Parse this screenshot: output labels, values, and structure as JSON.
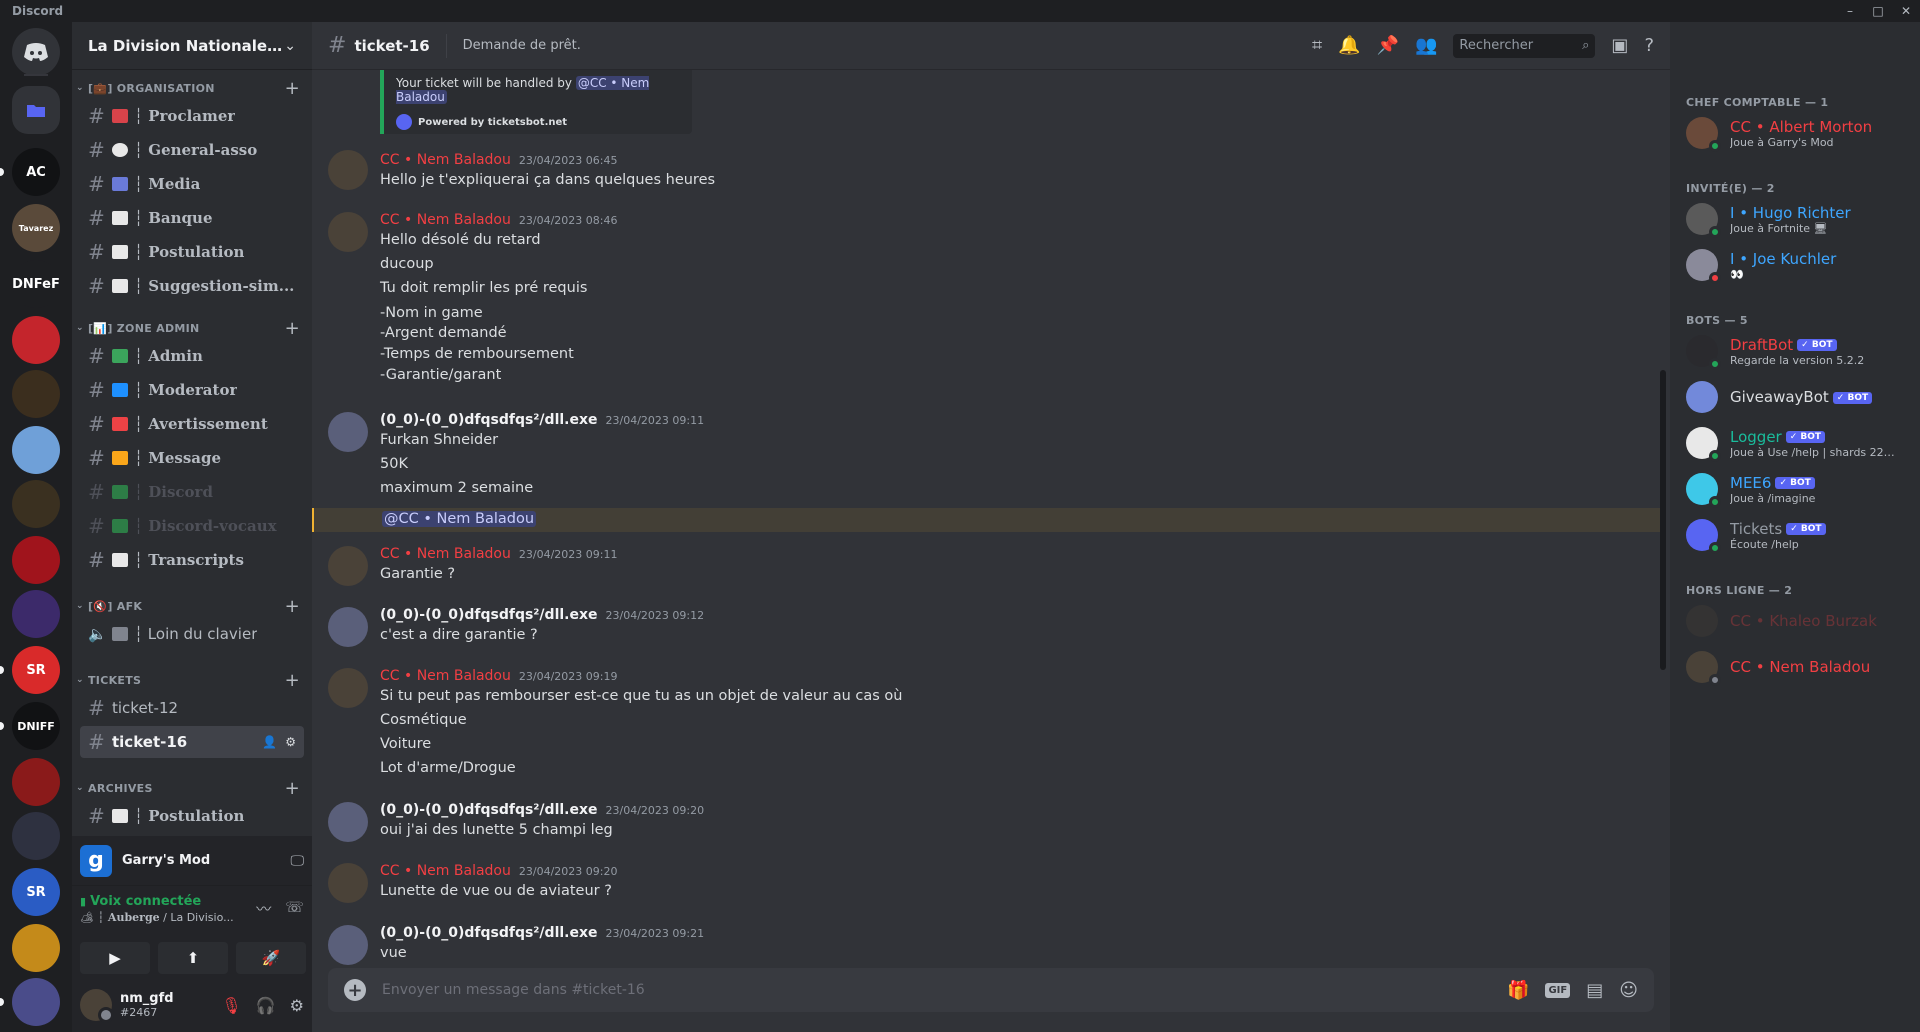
{
  "app": {
    "title": "Discord",
    "window_controls": [
      "–",
      "□",
      "✕"
    ]
  },
  "rail": {
    "servers": [
      {
        "label": "",
        "color": "#5865f2"
      },
      {
        "label": "AC",
        "color": "#111214"
      },
      {
        "label": "Tavarez",
        "color": "#5a4a3a"
      },
      {
        "label": "DNFeF",
        "color": "#1e1f22"
      },
      {
        "label": "",
        "color": "#c4252c"
      },
      {
        "label": "",
        "color": "#3b2e1e"
      },
      {
        "label": "",
        "color": "#6fa0d8"
      },
      {
        "label": "",
        "color": "#3a3020"
      },
      {
        "label": "",
        "color": "#a0141c"
      },
      {
        "label": "",
        "color": "#3c2a6a"
      },
      {
        "label": "SR",
        "color": "#d92a2a"
      },
      {
        "label": "DNIFF",
        "color": "#111214"
      },
      {
        "label": "",
        "color": "#8a1a1a"
      },
      {
        "label": "",
        "color": "#2e3140"
      },
      {
        "label": "SR",
        "color": "#2a5cc4"
      },
      {
        "label": "",
        "color": "#c48a1a"
      },
      {
        "label": "",
        "color": "#4a4c8a"
      }
    ]
  },
  "guild": {
    "name": "La Division Nationale d'I..."
  },
  "channels": {
    "categories": {
      "org": "[💼] ORGANISATION",
      "admin": "[📊] ZONE ADMIN",
      "afk": "[🔇] AFK",
      "tickets": "TICKETS",
      "archives": "ARCHIVES"
    },
    "items": [
      {
        "label": "┆ Proclamer",
        "emoji_color": "#d8434a"
      },
      {
        "label": "┆ General-asso",
        "emoji_color": "#e8e8e8"
      },
      {
        "label": "┆ Media",
        "emoji_color": "#6a7ad8"
      },
      {
        "label": "┆ Banque",
        "emoji_color": "#e8e8e8"
      },
      {
        "label": "┆ Postulation",
        "emoji_color": "#e8e8e8"
      },
      {
        "label": "┆ Suggestion-sim...",
        "emoji_color": "#e8e8e8"
      },
      {
        "label": "┆ Admin",
        "emoji_color": "#3ba55c"
      },
      {
        "label": "┆ Moderator",
        "emoji_color": "#1e90ff"
      },
      {
        "label": "┆ Avertissement",
        "emoji_color": "#ed4245"
      },
      {
        "label": "┆ Message",
        "emoji_color": "#faa61a"
      },
      {
        "label": "┆ Discord",
        "emoji_color": "#3ba55c"
      },
      {
        "label": "┆ Discord-vocaux",
        "emoji_color": "#3ba55c"
      },
      {
        "label": "┆ Transcripts",
        "emoji_color": "#e8e8e8"
      },
      {
        "label": "┆ Loin du clavier",
        "emoji_color": "#80848e"
      },
      {
        "label": "ticket-12"
      },
      {
        "label": "ticket-16"
      },
      {
        "label": "┆ Postulation",
        "emoji_color": "#e8e8e8"
      }
    ]
  },
  "activity": {
    "game": "Garry's Mod",
    "icon_letter": "g"
  },
  "voice": {
    "status": "Voix connectée",
    "channel": "┆ Auberge",
    "server": " / La Divisio..."
  },
  "user": {
    "name": "nm_gfd",
    "tag": "#2467"
  },
  "header": {
    "channel": "ticket-16",
    "topic": "Demande de prêt.",
    "search_placeholder": "Rechercher"
  },
  "embed": {
    "text": "Your ticket will be handled by ",
    "mention": "@CC • Nem Baladou",
    "powered": "Powered by ticketsbot.net"
  },
  "messages": [
    {
      "author": "CC • Nem Baladou",
      "time": "23/04/2023 06:45",
      "lines": [
        "Hello je t'expliquerai ça dans quelques heures"
      ]
    },
    {
      "author": "CC • Nem Baladou",
      "time": "23/04/2023 08:46",
      "lines": [
        "Hello désolé du retard",
        "ducoup",
        "Tu doit remplir les pré requis",
        "-Nom in game",
        "-Argent demandé",
        "-Temps de remboursement",
        "-Garantie/garant"
      ]
    },
    {
      "author": "(0_0)-(0_0)dfqsdfqs²/dll.exe",
      "time": "23/04/2023 09:11",
      "lines": [
        "Furkan Shneider",
        "50K",
        "maximum 2 semaine"
      ],
      "mention": "@CC • Nem Baladou"
    },
    {
      "author": "CC • Nem Baladou",
      "time": "23/04/2023 09:11",
      "lines": [
        "Garantie ?"
      ]
    },
    {
      "author": "(0_0)-(0_0)dfqsdfqs²/dll.exe",
      "time": "23/04/2023 09:12",
      "lines": [
        "c'est a dire garantie ?"
      ]
    },
    {
      "author": "CC • Nem Baladou",
      "time": "23/04/2023 09:19",
      "lines": [
        "Si tu peut pas rembourser est-ce que tu as un objet de valeur au cas où",
        "Cosmétique",
        "Voiture",
        "Lot d'arme/Drogue"
      ]
    },
    {
      "author": "(0_0)-(0_0)dfqsdfqs²/dll.exe",
      "time": "23/04/2023 09:20",
      "lines": [
        "oui j'ai des lunette 5 champi leg"
      ]
    },
    {
      "author": "CC • Nem Baladou",
      "time": "23/04/2023 09:20",
      "lines": [
        "Lunette de vue ou de aviateur ?"
      ]
    },
    {
      "author": "(0_0)-(0_0)dfqsdfqs²/dll.exe",
      "time": "23/04/2023 09:21",
      "lines": [
        "vue"
      ]
    }
  ],
  "composer": {
    "placeholder": "Envoyer un message dans #ticket-16",
    "gif": "GIF"
  },
  "members": {
    "groups": [
      "CHEF COMPTABLE — 1",
      "INVITÉ(E) — 2",
      "BOTS — 5",
      "HORS LIGNE — 2"
    ],
    "list": [
      {
        "name": "CC • Albert Morton",
        "activity": "Joue à Garry's Mod",
        "color": "#f23f43",
        "status": "#23a559"
      },
      {
        "name": "I • Hugo Richter",
        "activity": "Joue à Fortnite 🖥",
        "color": "#3ea6ff",
        "status": "#23a559"
      },
      {
        "name": "I • Joe Kuchler",
        "activity": "👀",
        "color": "#3ea6ff",
        "status": "#f23f43"
      },
      {
        "name": "DraftBot",
        "activity": "Regarde la version 5.2.2",
        "color": "#f23f43",
        "status": "#23a559",
        "bot": "✓ BOT"
      },
      {
        "name": "GiveawayBot",
        "activity": "",
        "color": "#dbdee1",
        "status": "",
        "bot": "✓ BOT"
      },
      {
        "name": "Logger",
        "activity": "Joue à Use /help | shards 224...",
        "color": "#1abc9c",
        "status": "#23a559",
        "bot": "✓ BOT"
      },
      {
        "name": "MEE6",
        "activity": "Joue à /imagine",
        "color": "#3ea6ff",
        "status": "#23a559",
        "bot": "✓ BOT"
      },
      {
        "name": "Tickets",
        "activity": "Écoute /help",
        "color": "#949ba4",
        "status": "#23a559",
        "bot": "✓ BOT"
      },
      {
        "name": "CC • Khaleo Burzak",
        "activity": "",
        "color": "#f23f43",
        "status": ""
      },
      {
        "name": "CC • Nem Baladou",
        "activity": "",
        "color": "#f23f43",
        "status": "#80848e"
      }
    ]
  }
}
